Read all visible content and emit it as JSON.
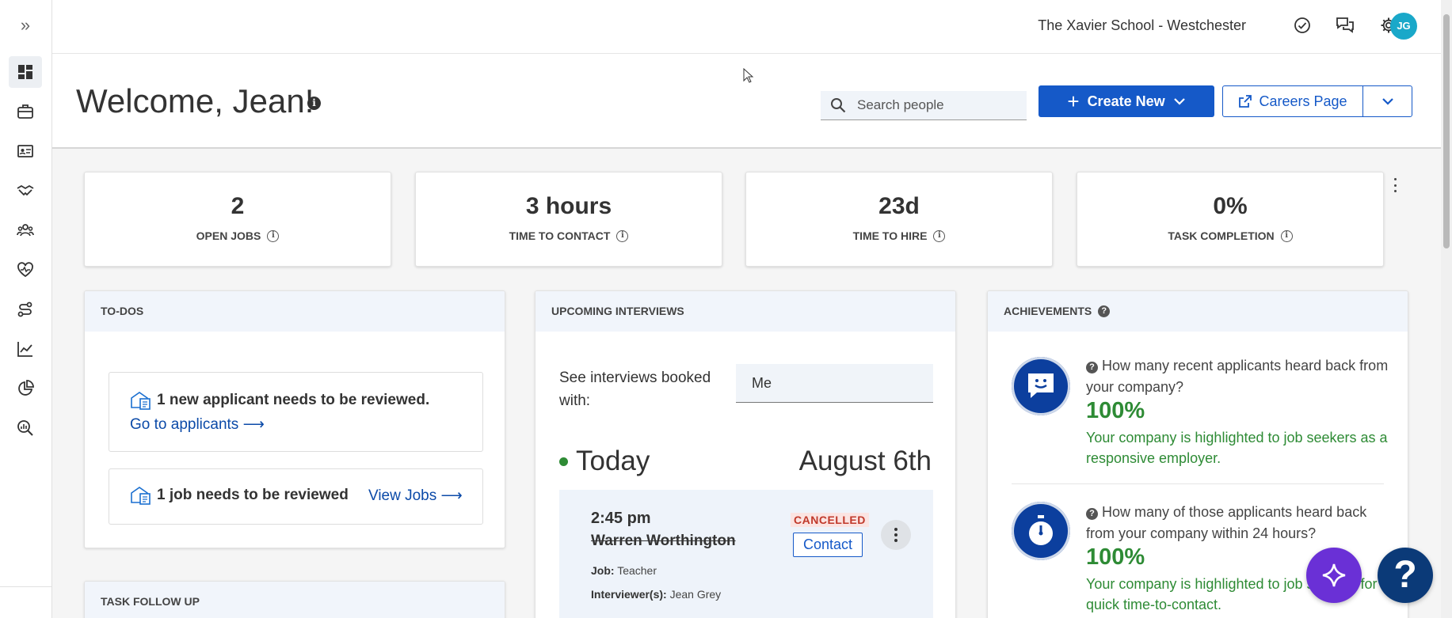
{
  "topbar": {
    "org_name": "The Xavier School - Westchester",
    "avatar_initials": "JG"
  },
  "header": {
    "welcome": "Welcome, Jean!",
    "search_placeholder": "Search people",
    "create_new_label": "Create New",
    "careers_page_label": "Careers Page"
  },
  "stats": [
    {
      "value": "2",
      "label": "OPEN JOBS"
    },
    {
      "value": "3 hours",
      "label": "TIME TO CONTACT"
    },
    {
      "value": "23d",
      "label": "TIME TO HIRE"
    },
    {
      "value": "0%",
      "label": "TASK COMPLETION"
    }
  ],
  "todos": {
    "title": "TO-DOS",
    "items": [
      {
        "text": "1 new applicant needs to be reviewed.",
        "link": "Go to applicants ⟶"
      },
      {
        "text": "1 job needs to be reviewed",
        "link": "View Jobs ⟶"
      }
    ]
  },
  "task_follow_up": {
    "title": "TASK FOLLOW UP"
  },
  "interviews": {
    "title": "UPCOMING INTERVIEWS",
    "booked_with_label": "See interviews booked with:",
    "booked_with_value": "Me",
    "day_label": "Today",
    "date_label": "August 6th",
    "items": [
      {
        "time": "2:45 pm",
        "name": "Warren Worthington",
        "status": "CANCELLED",
        "contact_label": "Contact",
        "job_label": "Job:",
        "job_value": "Teacher",
        "interviewer_label": "Interviewer(s):",
        "interviewer_value": "Jean Grey"
      }
    ]
  },
  "achievements": {
    "title": "ACHIEVEMENTS",
    "items": [
      {
        "question": "How many recent applicants heard back from your company?",
        "percent": "100%",
        "note": "Your company is highlighted to job seekers as a responsive employer."
      },
      {
        "question": "How many of those applicants heard back from your company within 24 hours?",
        "percent": "100%",
        "note": "Your company is highlighted to job seekers for quick time-to-contact."
      }
    ]
  },
  "colors": {
    "primary": "#1559c8",
    "success": "#2e8b35",
    "danger": "#c0392b",
    "avatar": "#1aa8c9",
    "fab_purple": "#6a30d6",
    "fab_navy": "#0b3a78"
  },
  "icons": {
    "rail": [
      "dashboard-icon",
      "briefcase-icon",
      "id-card-icon",
      "handshake-icon",
      "people-icon",
      "heart-pulse-icon",
      "route-icon",
      "line-chart-icon",
      "pie-chart-icon",
      "analytics-search-icon"
    ],
    "topbar": [
      "check-circle-icon",
      "chat-icon",
      "gear-icon"
    ]
  }
}
